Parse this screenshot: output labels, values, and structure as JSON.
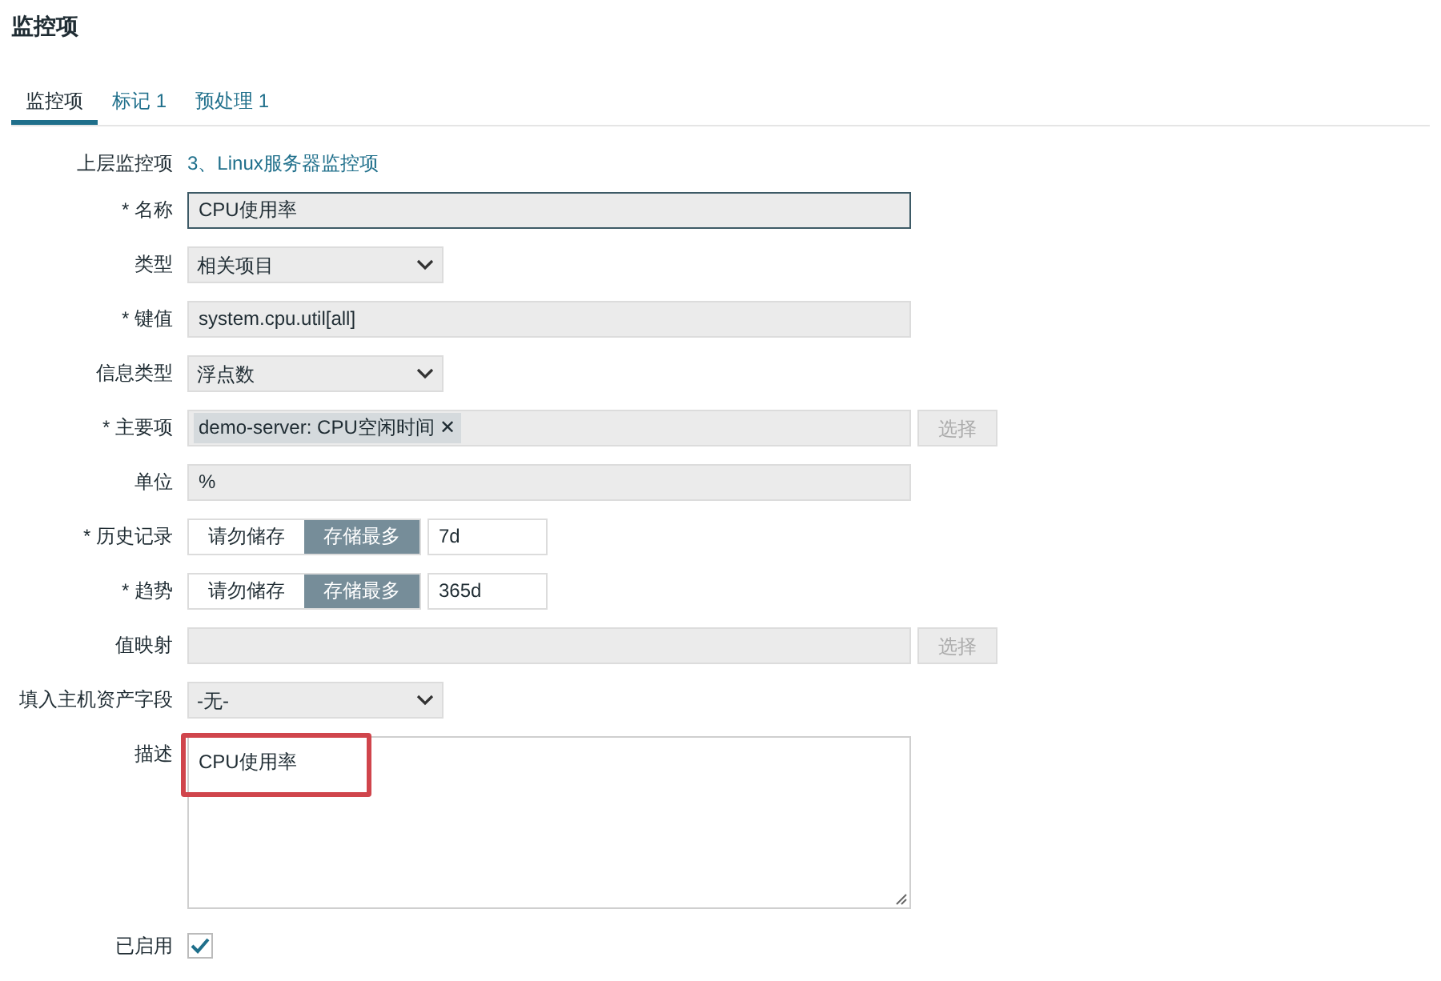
{
  "page_title": "监控项",
  "tabs": [
    {
      "label": "监控项",
      "selected": true
    },
    {
      "label": "标记 1",
      "selected": false
    },
    {
      "label": "预处理 1",
      "selected": false
    }
  ],
  "fields": [
    {
      "kind": "link",
      "label": "上层监控项",
      "value": "3、Linux服务器监控项"
    },
    {
      "kind": "text",
      "label": "* 名称",
      "value": "CPU使用率",
      "focused": true,
      "readonly": true
    },
    {
      "kind": "select",
      "label": "类型",
      "value": "相关项目"
    },
    {
      "kind": "text",
      "label": "* 键值",
      "value": "system.cpu.util[all]",
      "focused": false,
      "readonly": true
    },
    {
      "kind": "select",
      "label": "信息类型",
      "value": "浮点数"
    },
    {
      "kind": "multiselect",
      "label": "* 主要项",
      "tag": "demo-server: CPU空闲时间 ✕",
      "button": "选择",
      "disabled": true
    },
    {
      "kind": "text",
      "label": "单位",
      "value": "%",
      "focused": false,
      "readonly": true
    },
    {
      "kind": "segmented",
      "label": "* 历史记录",
      "options": [
        {
          "label": "请勿储存",
          "selected": false
        },
        {
          "label": "存储最多",
          "selected": true
        }
      ],
      "value": "7d"
    },
    {
      "kind": "segmented",
      "label": "* 趋势",
      "options": [
        {
          "label": "请勿储存",
          "selected": false
        },
        {
          "label": "存储最多",
          "selected": true
        }
      ],
      "value": "365d"
    },
    {
      "kind": "multiselect",
      "label": "值映射",
      "button": "选择",
      "disabled": true
    },
    {
      "kind": "select",
      "label": "填入主机资产字段",
      "value": "-无-"
    },
    {
      "kind": "textarea",
      "label": "描述",
      "value": "CPU使用率",
      "highlighted": true
    },
    {
      "kind": "checkbox",
      "label": "已启用",
      "checked": true
    }
  ]
}
